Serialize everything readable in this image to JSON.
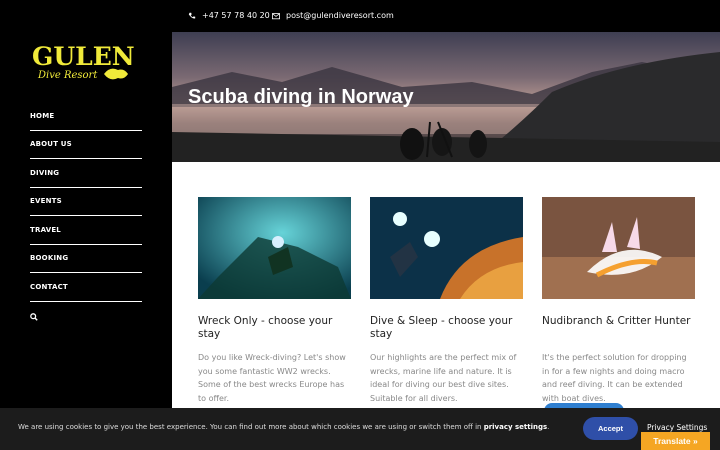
{
  "header": {
    "phone": "+47 57 78 40 20",
    "email": "post@gulendiveresort.com"
  },
  "logo": {
    "line1": "GULEN",
    "line2": "Dive Resort"
  },
  "nav": {
    "items": [
      "HOME",
      "ABOUT US",
      "DIVING",
      "EVENTS",
      "TRAVEL",
      "BOOKING",
      "CONTACT"
    ]
  },
  "hero": {
    "title": "Scuba diving in Norway"
  },
  "cards": [
    {
      "title": "Wreck Only - choose your stay",
      "desc": "Do you like Wreck-diving? Let's show you some fantastic WW2 wrecks. Some of the best wrecks Europe has to offer."
    },
    {
      "title": "Dive & Sleep - choose your stay",
      "desc": "Our highlights are the perfect mix of wrecks, marine life and nature. It is ideal for diving our best dive sites. Suitable for all divers."
    },
    {
      "title": "Nudibranch & Critter Hunter",
      "desc": "It's the perfect solution for dropping in for a few nights and doing macro and reef diving. It can be extended with boat dives."
    }
  ],
  "cookie": {
    "message_pre": "We are using cookies to give you the best experience. You can find out more about which cookies we are using or switch them off in ",
    "message_link": "privacy settings",
    "message_post": ".",
    "accept": "Accept",
    "privacy": "Privacy Settings"
  },
  "translate": {
    "label": "Translate »"
  }
}
